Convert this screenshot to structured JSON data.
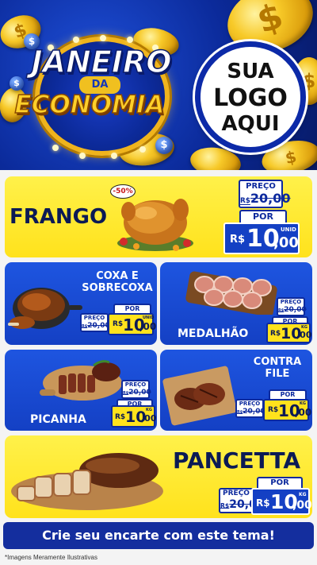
{
  "header": {
    "title_line1": "JANEIRO",
    "title_line2": "DA",
    "title_line3": "ECONOMIA",
    "logo_line1": "SUA",
    "logo_line2": "LOGO",
    "logo_line3": "AQUI"
  },
  "currency_symbol": "$",
  "products": {
    "frango": {
      "name": "FRANGO",
      "badge": "-50%",
      "old_label": "PREÇO",
      "old_price": "20,00",
      "old_currency": "R$",
      "new_label": "POR",
      "currency": "R$",
      "price_int": "10",
      "price_dec": ",00",
      "unit": "UNID"
    },
    "coxa": {
      "name_line1": "COXA E",
      "name_line2": "SOBRECOXA",
      "old_label": "PREÇO",
      "old_price": "20,00",
      "old_currency": "R$",
      "new_label": "POR",
      "currency": "R$",
      "price_int": "10",
      "price_dec": ",00",
      "unit": "UNID"
    },
    "medalhao": {
      "name": "MEDALHÃO",
      "old_label": "PREÇO",
      "old_price": "20,00",
      "old_currency": "R$",
      "new_label": "POR",
      "currency": "R$",
      "price_int": "10",
      "price_dec": ",00",
      "unit": "KG"
    },
    "picanha": {
      "name": "PICANHA",
      "old_label": "PREÇO",
      "old_price": "20,00",
      "old_currency": "R$",
      "new_label": "POR",
      "currency": "R$",
      "price_int": "10",
      "price_dec": ",00",
      "unit": "KG"
    },
    "contra_file": {
      "name_line1": "CONTRA",
      "name_line2": "FILE",
      "old_label": "PREÇO",
      "old_price": "20,00",
      "old_currency": "R$",
      "new_label": "POR",
      "currency": "R$",
      "price_int": "10",
      "price_dec": ",00",
      "unit": "KG"
    },
    "pancetta": {
      "name": "PANCETTA",
      "old_label": "PREÇO",
      "old_price": "20,00",
      "old_currency": "R$",
      "new_label": "POR",
      "currency": "R$",
      "price_int": "10",
      "price_dec": ",00",
      "unit": "KG"
    }
  },
  "footer": {
    "cta": "Crie seu encarte com este tema!",
    "disclaimer": "*Imagens Meramente Ilustrativas"
  },
  "colors": {
    "brand_blue": "#1440c4",
    "brand_yellow": "#ffe21c",
    "navy": "#0d2a9e",
    "gold": "#f0b41c"
  }
}
